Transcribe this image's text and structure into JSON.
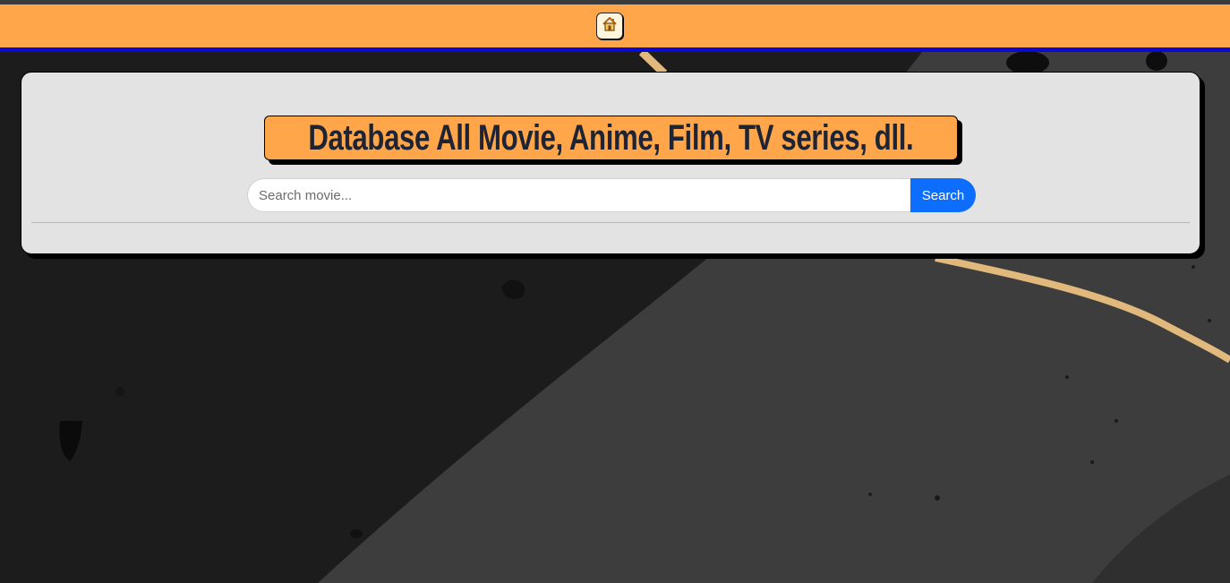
{
  "navbar": {
    "home_icon": "home-icon",
    "colors": {
      "bar": "#ffa64a",
      "underline": "#0a0ad6"
    }
  },
  "hero": {
    "title": "Database All Movie, Anime, Film, TV series, dll.",
    "colors": {
      "card": "#e3e3e3",
      "title_box": "#ffa64a",
      "title_text": "#1e2433"
    }
  },
  "search": {
    "placeholder": "Search movie...",
    "value": "",
    "button_label": "Search",
    "button_color": "#0d6efd"
  },
  "background": {
    "colors": {
      "dark": "#1c1c1c",
      "gray": "#3d3d3d",
      "stripe": "#e2b97c"
    }
  }
}
